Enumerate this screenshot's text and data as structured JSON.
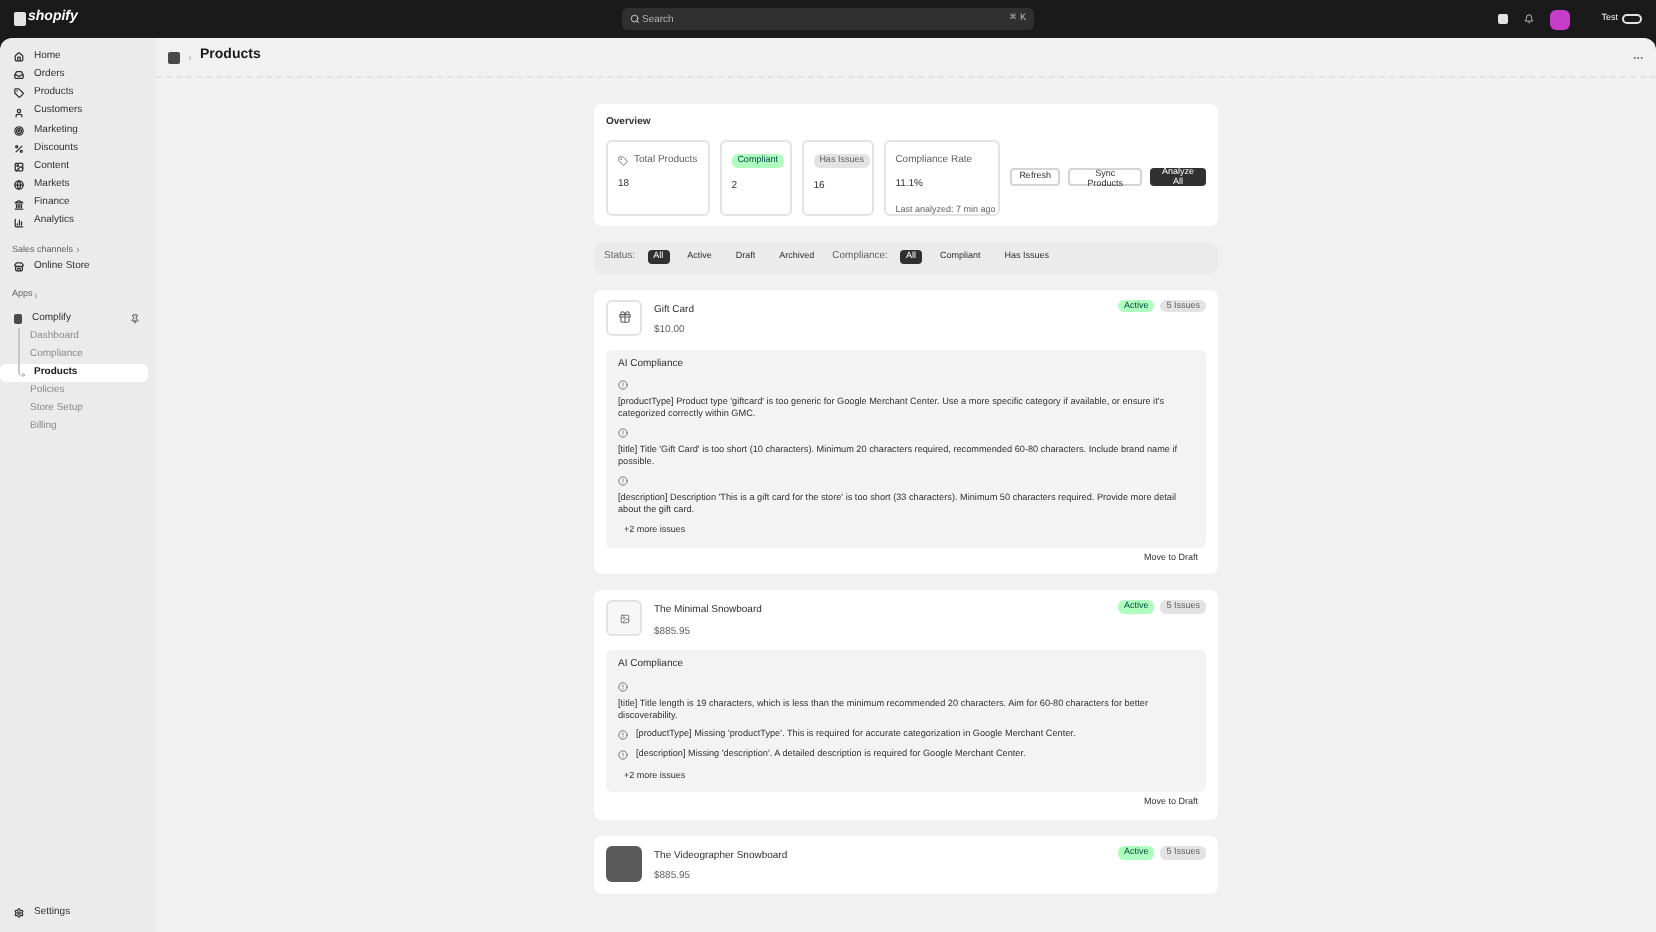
{
  "topbar": {
    "logo": "shopify",
    "search": {
      "placeholder": "Search",
      "shortcut": [
        "⌘",
        "K"
      ]
    },
    "store": "Test"
  },
  "sidebar": {
    "items": [
      {
        "label": "Home",
        "selected": false
      },
      {
        "label": "Orders",
        "selected": false
      },
      {
        "label": "Products",
        "selected": false
      },
      {
        "label": "Customers",
        "selected": false
      },
      {
        "label": "Marketing",
        "selected": false
      },
      {
        "label": "Discounts",
        "selected": false
      },
      {
        "label": "Content",
        "selected": false
      },
      {
        "label": "Markets",
        "selected": false
      },
      {
        "label": "Finance",
        "selected": false
      },
      {
        "label": "Analytics",
        "selected": false
      }
    ],
    "sales_channels": {
      "heading": "Sales channels",
      "items": [
        {
          "label": "Online Store",
          "selected": false
        }
      ]
    },
    "apps": {
      "heading": "Apps",
      "app": {
        "label": "Complify",
        "children": [
          {
            "label": "Dashboard",
            "selected": false
          },
          {
            "label": "Compliance",
            "selected": false
          },
          {
            "label": "Products",
            "selected": true
          },
          {
            "label": "Policies",
            "selected": false
          },
          {
            "label": "Store Setup",
            "selected": false
          },
          {
            "label": "Billing",
            "selected": false
          }
        ]
      }
    },
    "settings": "Settings"
  },
  "page": {
    "title": "Products"
  },
  "overview": {
    "title": "Overview",
    "stats": [
      {
        "kind": "plain",
        "label": "Total Products",
        "value": "18"
      },
      {
        "kind": "success",
        "label": "Compliant",
        "value": "2"
      },
      {
        "kind": "neutral",
        "label": "Has Issues",
        "value": "16"
      },
      {
        "kind": "rate",
        "label": "Compliance Rate",
        "value": "11.1%",
        "note": "Last analyzed: 7 min ago"
      }
    ],
    "buttons": [
      {
        "label": "Refresh",
        "primary": false
      },
      {
        "label": "Sync Products",
        "primary": false
      },
      {
        "label": "Analyze All",
        "primary": true
      }
    ]
  },
  "filters": [
    {
      "label": "Status:",
      "options": [
        {
          "label": "All",
          "selected": true
        },
        {
          "label": "Active",
          "selected": false
        },
        {
          "label": "Draft",
          "selected": false
        },
        {
          "label": "Archived",
          "selected": false
        }
      ]
    },
    {
      "label": "Compliance:",
      "options": [
        {
          "label": "All",
          "selected": true
        },
        {
          "label": "Compliant",
          "selected": false
        },
        {
          "label": "Has Issues",
          "selected": false
        }
      ]
    }
  ],
  "products": [
    {
      "title": "Gift Card",
      "price": "$10.00",
      "kind": "icon",
      "status": "Active",
      "issues": "5 Issues",
      "compliance": {
        "title": "AI Compliance",
        "issues": [
          {
            "kind": "stacked",
            "text": "[productType] Product type 'giftcard' is too generic for Google Merchant Center. Use a more specific category if available, or ensure it's categorized correctly within GMC."
          },
          {
            "kind": "stacked",
            "text": "[title] Title 'Gift Card' is too short (10 characters). Minimum 20 characters required, recommended 60-80 characters. Include brand name if possible."
          },
          {
            "kind": "stacked",
            "text": "[description] Description 'This is a gift card for the store' is too short (33 characters). Minimum 50 characters required. Provide more detail about the gift card."
          }
        ],
        "more": "+2 more issues"
      },
      "action": "Move to Draft"
    },
    {
      "title": "The Minimal Snowboard",
      "price": "$885.95",
      "kind": "empty",
      "status": "Active",
      "issues": "5 Issues",
      "compliance": {
        "title": "AI Compliance",
        "issues": [
          {
            "kind": "stacked",
            "text": "[title] Title length is 19 characters, which is less than the minimum recommended 20 characters. Aim for 60-80 characters for better discoverability."
          },
          {
            "kind": "inline",
            "text": "[productType] Missing 'productType'. This is required for accurate categorization in Google Merchant Center."
          },
          {
            "kind": "inline",
            "text": "[description] Missing 'description'. A detailed description is required for Google Merchant Center."
          }
        ],
        "more": "+2 more issues"
      },
      "action": "Move to Draft"
    },
    {
      "title": "The Videographer Snowboard",
      "price": "$885.95",
      "kind": "photo",
      "status": "Active",
      "issues": "5 Issues"
    }
  ]
}
